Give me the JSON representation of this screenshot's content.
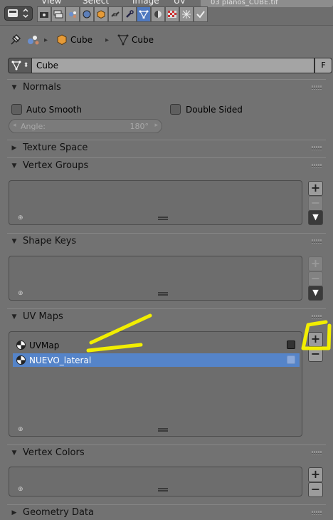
{
  "top_menu": [
    "View",
    "Select",
    "Image",
    "UV"
  ],
  "filename": "03 planos_CUBE.tif",
  "breadcrumb": {
    "object": "Cube",
    "mesh": "Cube"
  },
  "datablock": {
    "name": "Cube",
    "fake_user": "F"
  },
  "panels": {
    "normals": {
      "title": "Normals",
      "auto_smooth": "Auto Smooth",
      "double_sided": "Double Sided",
      "angle_label": "Angle:",
      "angle_value": "180°"
    },
    "texture_space": {
      "title": "Texture Space"
    },
    "vertex_groups": {
      "title": "Vertex Groups"
    },
    "shape_keys": {
      "title": "Shape Keys"
    },
    "uv_maps": {
      "title": "UV Maps",
      "items": [
        {
          "name": "UVMap",
          "selected": false
        },
        {
          "name": "NUEVO_lateral",
          "selected": true
        }
      ]
    },
    "vertex_colors": {
      "title": "Vertex Colors"
    },
    "geometry_data": {
      "title": "Geometry Data"
    }
  },
  "icons": {
    "pin": "pin-icon",
    "plus": "+",
    "minus": "−",
    "down": "▼"
  },
  "colors": {
    "accent": "#5584c9",
    "annotation": "#f2ee00"
  }
}
